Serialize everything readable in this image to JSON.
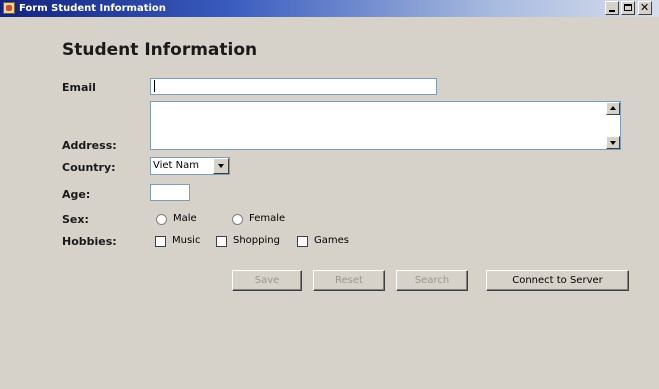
{
  "window": {
    "title": "Form Student Information"
  },
  "form": {
    "heading": "Student Information",
    "labels": {
      "email": "Email",
      "address": "Address:",
      "country": "Country:",
      "age": "Age:",
      "sex": "Sex:",
      "hobbies": "Hobbies:"
    },
    "email_value": "",
    "address_value": "",
    "country_selected": "Viet Nam",
    "age_value": "",
    "sex_options": [
      {
        "label": "Male",
        "selected": false
      },
      {
        "label": "Female",
        "selected": false
      }
    ],
    "hobbies": [
      {
        "label": "Music",
        "checked": false
      },
      {
        "label": "Shopping",
        "checked": false
      },
      {
        "label": "Games",
        "checked": false
      }
    ]
  },
  "buttons": {
    "save": "Save",
    "reset": "Reset",
    "search": "Search",
    "connect": "Connect to Server"
  },
  "icons": {
    "window_icon": "java-cup-icon",
    "minimize": "minimize-icon",
    "maximize": "maximize-icon",
    "close": "close-icon",
    "combo_arrow": "chevron-down-icon",
    "scroll_up": "arrow-up-icon",
    "scroll_down": "arrow-down-icon"
  },
  "colors": {
    "window_bg": "#d6d2ca",
    "title_bar_start": "#12237f",
    "title_bar_end": "#d7ddec",
    "field_border": "#7f9db9",
    "disabled_text": "#9a9690"
  }
}
